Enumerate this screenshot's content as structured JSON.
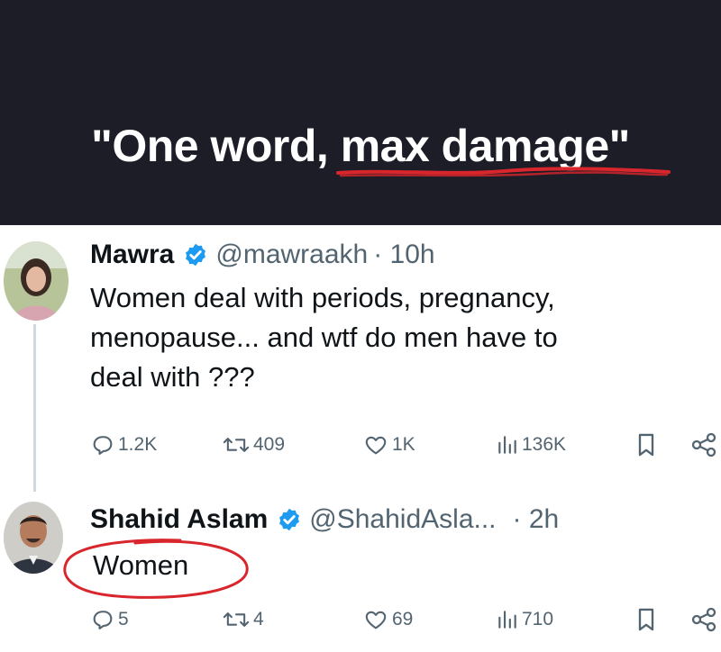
{
  "headline": {
    "part1": "\"One word, ",
    "part2": "max damage",
    "part3": "\""
  },
  "colors": {
    "headline_bg": "#1c1d27",
    "verified": "#1d9bf0",
    "annotation_red": "#d9262c",
    "text": "#0f1419",
    "muted": "#536471"
  },
  "tweet1": {
    "name": "Mawra",
    "handle": "@mawraakh",
    "time": "· 10h",
    "lines": [
      "Women deal with periods, pregnancy,",
      "menopause... and wtf do men have to",
      "deal with ???"
    ],
    "actions": {
      "replies": "1.2K",
      "retweets": "409",
      "likes": "1K",
      "views": "136K"
    }
  },
  "tweet2": {
    "name": "Shahid Aslam",
    "handle": "@ShahidAsla...",
    "time": "· 2h",
    "text": "Women",
    "actions": {
      "replies": "5",
      "retweets": "4",
      "likes": "69",
      "views": "710"
    }
  },
  "icons": [
    "verified-badge-icon",
    "reply-icon",
    "retweet-icon",
    "like-icon",
    "views-icon",
    "bookmark-icon",
    "share-icon"
  ]
}
